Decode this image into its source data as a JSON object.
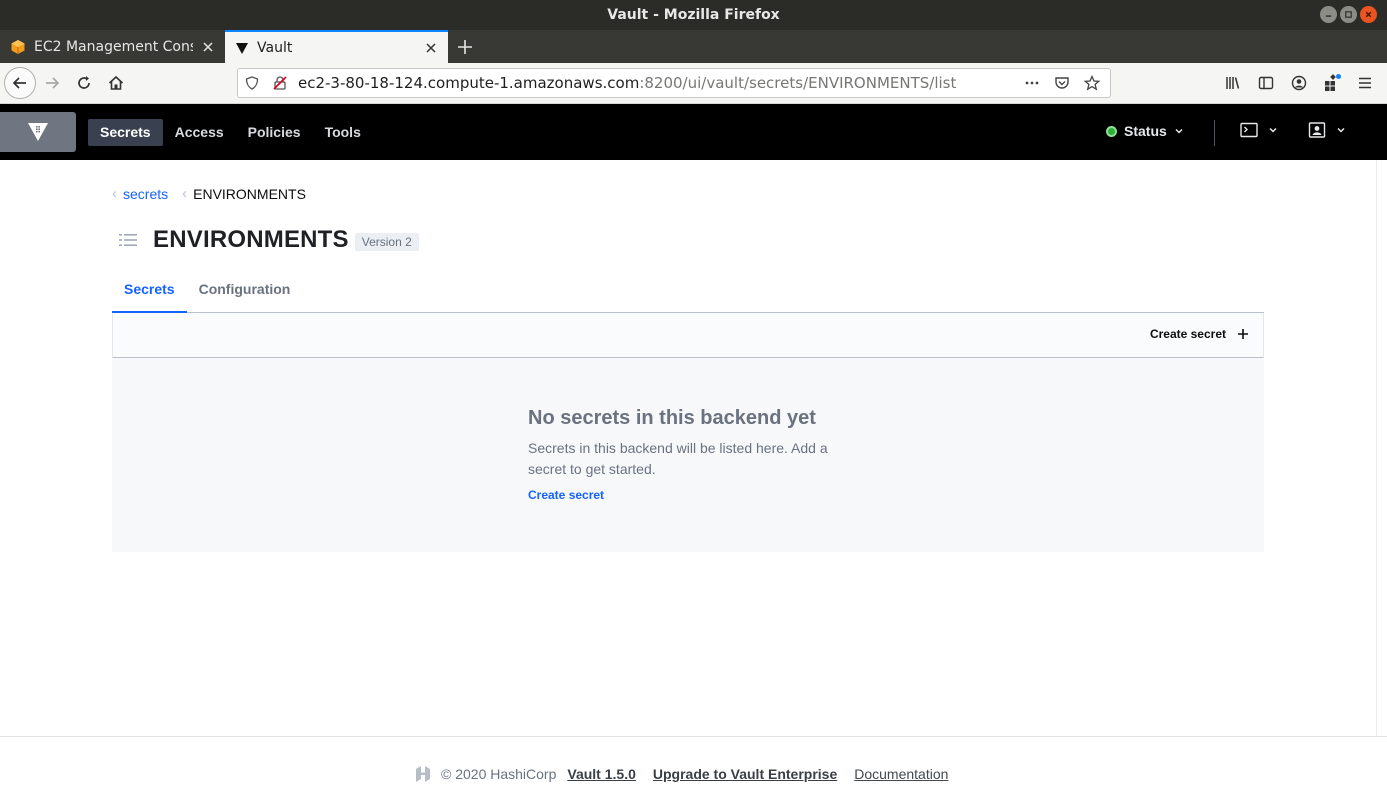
{
  "window": {
    "title": "Vault - Mozilla Firefox"
  },
  "tabs": [
    {
      "label": "EC2 Management Conso",
      "active": false,
      "icon": "aws-box-icon"
    },
    {
      "label": "Vault",
      "active": true,
      "icon": "vault-triangle-icon"
    }
  ],
  "urlbar": {
    "host": "ec2-3-80-18-124.compute-1.amazonaws.com",
    "path": ":8200/ui/vault/secrets/ENVIRONMENTS/list"
  },
  "vault_nav": {
    "items": [
      "Secrets",
      "Access",
      "Policies",
      "Tools"
    ],
    "active_index": 0,
    "status_label": "Status",
    "status_color": "#2eb039"
  },
  "breadcrumb": {
    "parent": "secrets",
    "current": "ENVIRONMENTS"
  },
  "page": {
    "title": "ENVIRONMENTS",
    "version_badge": "Version 2",
    "tabs": [
      "Secrets",
      "Configuration"
    ],
    "create_secret_label": "Create secret"
  },
  "empty_state": {
    "title": "No secrets in this backend yet",
    "message": "Secrets in this backend will be listed here. Add a secret to get started.",
    "link": "Create secret"
  },
  "footer": {
    "copyright": "© 2020 HashiCorp",
    "version_link": "Vault 1.5.0",
    "upgrade_link": "Upgrade to Vault Enterprise",
    "docs_link": "Documentation"
  },
  "colors": {
    "accent": "#1563ff",
    "header_bg": "#000000",
    "active_nav_bg": "#394150"
  }
}
